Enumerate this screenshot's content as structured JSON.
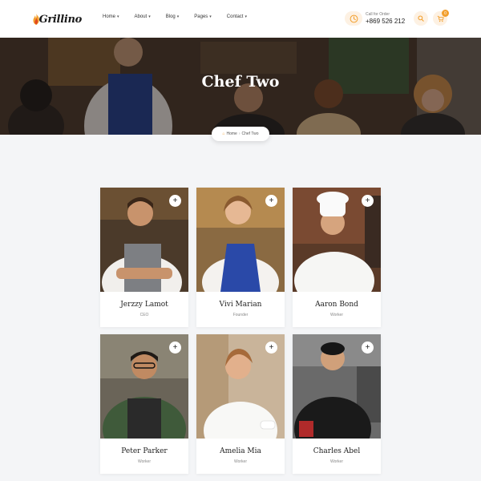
{
  "brand": {
    "name": "Grillino"
  },
  "nav": [
    {
      "label": "Home"
    },
    {
      "label": "About"
    },
    {
      "label": "Blog"
    },
    {
      "label": "Pages"
    },
    {
      "label": "Contact"
    }
  ],
  "order": {
    "label": "Call for Order",
    "phone": "+869 526 212"
  },
  "cart": {
    "count": "0"
  },
  "hero": {
    "title": "Chef Two"
  },
  "breadcrumb": {
    "home": "Home",
    "current": "Chef Two"
  },
  "chefs": [
    {
      "name": "Jerzzy Lamot",
      "role": "CEO"
    },
    {
      "name": "Vivi Marian",
      "role": "Founder"
    },
    {
      "name": "Aaron Bond",
      "role": "Worker"
    },
    {
      "name": "Peter Parker",
      "role": "Worker"
    },
    {
      "name": "Amelia Mia",
      "role": "Worker"
    },
    {
      "name": "Charles Abel",
      "role": "Worker"
    }
  ],
  "colors": {
    "accent": "#f29f2d",
    "accent_soft": "#fdf1e3",
    "background": "#f4f5f7"
  }
}
